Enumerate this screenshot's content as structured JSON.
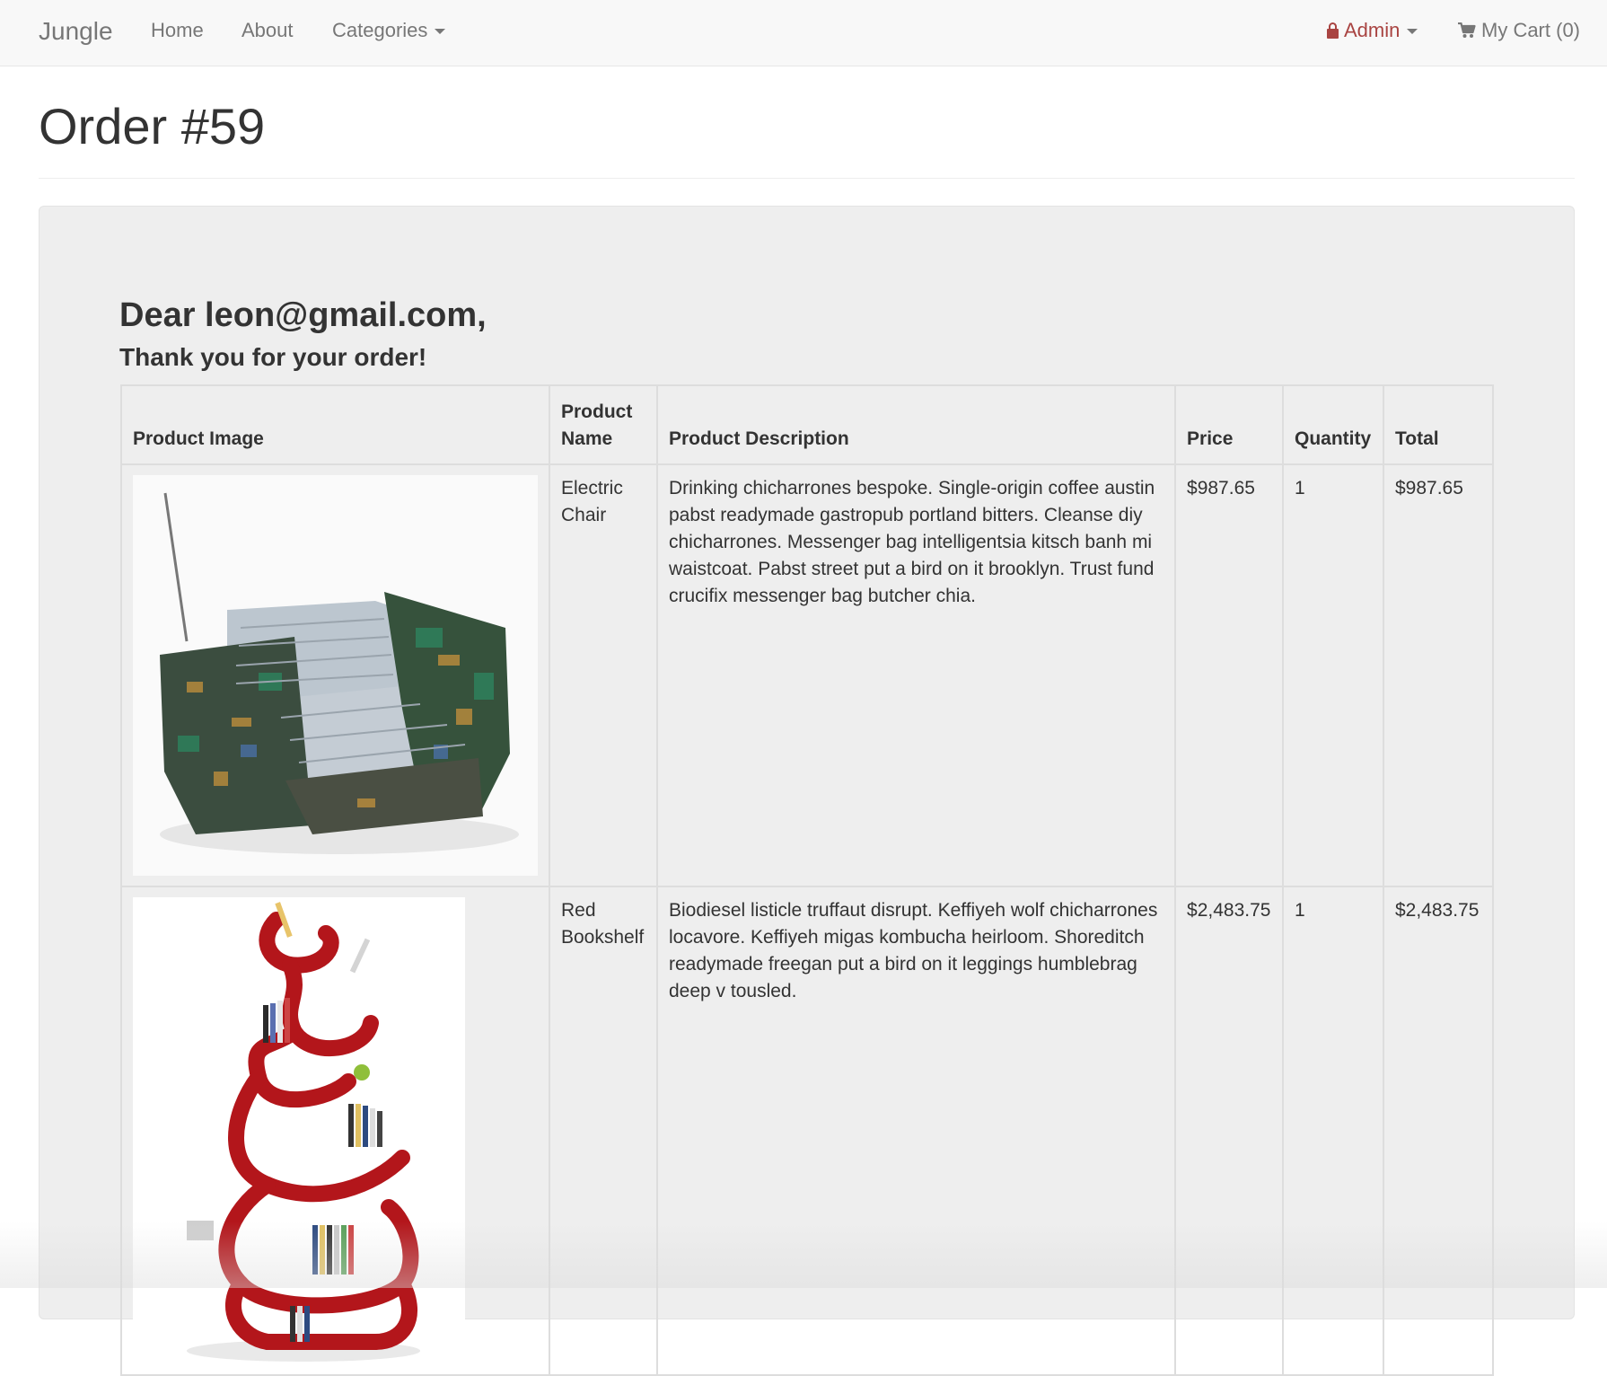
{
  "navbar": {
    "brand": "Jungle",
    "home": "Home",
    "about": "About",
    "categories": "Categories",
    "admin": "Admin",
    "cart": "My Cart (0)"
  },
  "page": {
    "title": "Order #59",
    "greeting": "Dear leon@gmail.com,",
    "thanks": "Thank you for your order!"
  },
  "table": {
    "headers": [
      "Product Image",
      "Product Name",
      "Product Description",
      "Price",
      "Quantity",
      "Total"
    ],
    "rows": [
      {
        "image_icon": "electric-chair-image",
        "name": "Electric Chair",
        "description": "Drinking chicharrones bespoke. Single-origin coffee austin pabst readymade gastropub portland bitters. Cleanse diy chicharrones. Messenger bag intelligentsia kitsch banh mi waistcoat. Pabst street put a bird on it brooklyn. Trust fund crucifix messenger bag butcher chia.",
        "price": "$987.65",
        "quantity": "1",
        "total": "$987.65"
      },
      {
        "image_icon": "red-bookshelf-image",
        "name": "Red Bookshelf",
        "description": "Biodiesel listicle truffaut disrupt. Keffiyeh wolf chicharrones locavore. Keffiyeh migas kombucha heirloom. Shoreditch readymade freegan put a bird on it leggings humblebrag deep v tousled.",
        "price": "$2,483.75",
        "quantity": "1",
        "total": "$2,483.75"
      }
    ]
  },
  "colors": {
    "navbar_bg": "#f8f8f8",
    "admin": "#a94442",
    "well_bg": "#eeeeee",
    "bookshelf_red": "#b3161b"
  }
}
